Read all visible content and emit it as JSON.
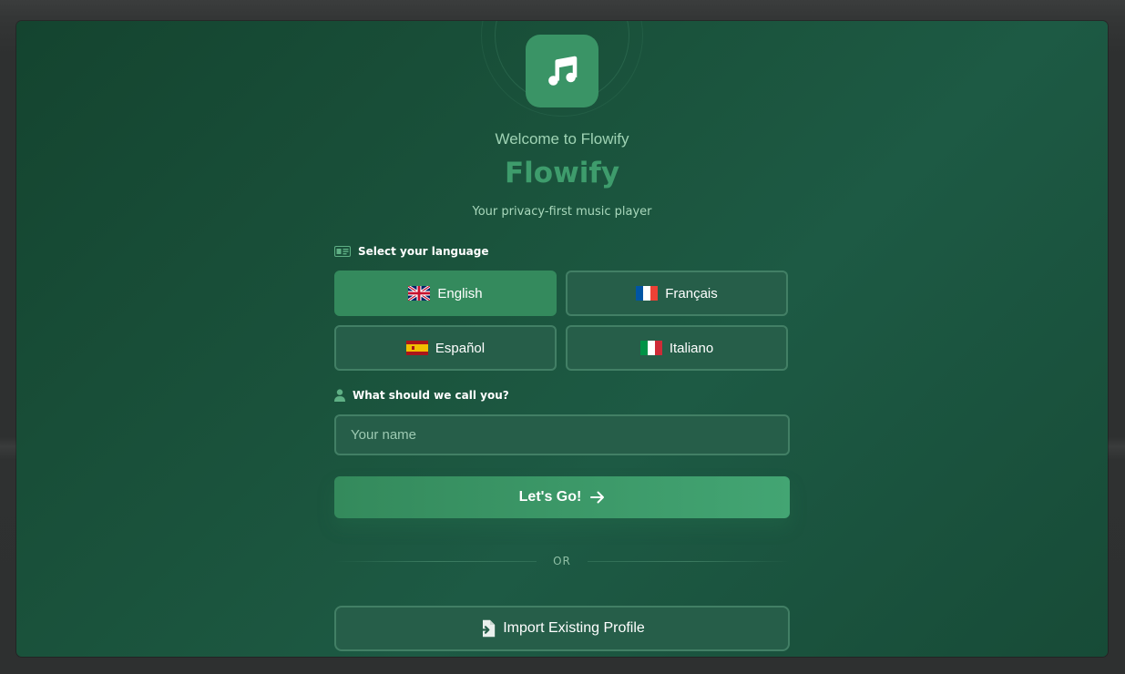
{
  "app": {
    "welcome_text": "Welcome to Flowify",
    "brand_name": "Flowify",
    "tagline": "Your privacy-first music player"
  },
  "language_section": {
    "label": "Select your language",
    "icon": "language-card-icon",
    "selected": "English",
    "options": [
      {
        "label": "English",
        "flag": "uk-flag-icon",
        "selected": true
      },
      {
        "label": "Français",
        "flag": "france-flag-icon",
        "selected": false
      },
      {
        "label": "Español",
        "flag": "spain-flag-icon",
        "selected": false
      },
      {
        "label": "Italiano",
        "flag": "italy-flag-icon",
        "selected": false
      }
    ]
  },
  "name_section": {
    "label": "What should we call you?",
    "icon": "user-icon",
    "value": "",
    "placeholder": "Your name"
  },
  "actions": {
    "go_label": "Let's Go!",
    "go_icon": "arrow-right-icon",
    "divider_text": "OR",
    "import_label": "Import Existing Profile",
    "import_icon": "file-import-icon"
  },
  "colors": {
    "accent": "#3e9c6c",
    "button_primary": "#348a5d",
    "modal_background": "#1b553e"
  }
}
